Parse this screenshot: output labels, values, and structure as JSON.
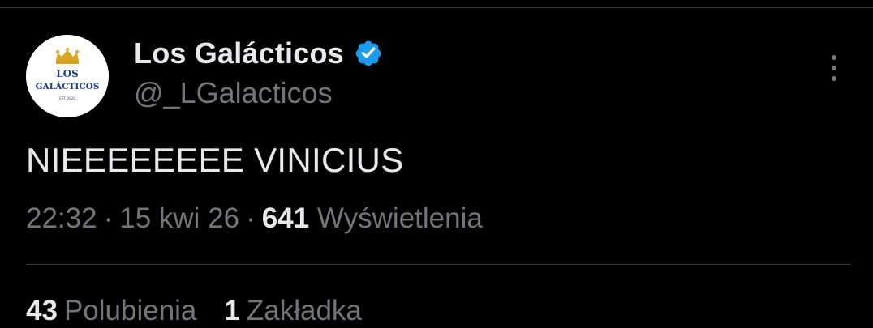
{
  "author": {
    "display_name": "Los Galácticos",
    "handle": "@_LGalacticos",
    "verified": true,
    "avatar": {
      "logo_line1": "LOS",
      "logo_line2": "GALÁCTICOS",
      "logo_small": "EST. 2020"
    }
  },
  "tweet": {
    "text": "NIEEEEEEEE VINICIUS"
  },
  "meta": {
    "time": "22:32",
    "separator": "·",
    "date": "15 kwi 26",
    "views_count": "641",
    "views_label": "Wyświetlenia"
  },
  "stats": {
    "likes_count": "43",
    "likes_label": "Polubienia",
    "bookmarks_count": "1",
    "bookmarks_label": "Zakładka"
  },
  "icons": {
    "more": "more-vertical-icon",
    "verified": "verified-badge-icon",
    "crown": "crown-icon"
  },
  "colors": {
    "background": "#000000",
    "primary_text": "#e7e9ea",
    "secondary_text": "#71767b",
    "divider": "#2f3336",
    "verified_blue": "#1d9bf0",
    "logo_navy": "#1f3f8a",
    "logo_gold": "#d9a520"
  }
}
